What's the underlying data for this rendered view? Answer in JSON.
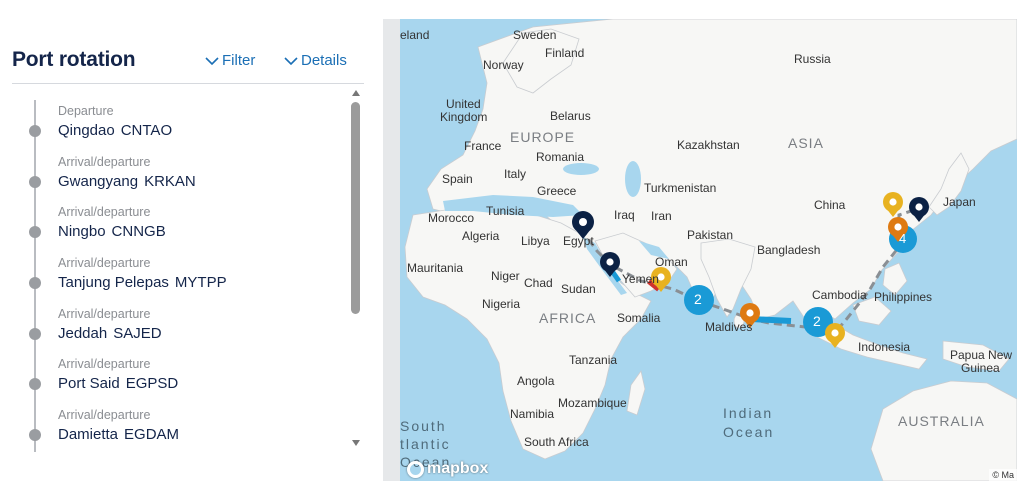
{
  "panel": {
    "title": "Port rotation",
    "filter_label": "Filter",
    "details_label": "Details",
    "stops": [
      {
        "kind": "Departure",
        "name": "Qingdao",
        "code": "CNTAO"
      },
      {
        "kind": "Arrival/departure",
        "name": "Gwangyang",
        "code": "KRKAN"
      },
      {
        "kind": "Arrival/departure",
        "name": "Ningbo",
        "code": "CNNGB"
      },
      {
        "kind": "Arrival/departure",
        "name": "Tanjung Pelepas",
        "code": "MYTPP"
      },
      {
        "kind": "Arrival/departure",
        "name": "Jeddah",
        "code": "SAJED"
      },
      {
        "kind": "Arrival/departure",
        "name": "Port Said",
        "code": "EGPSD"
      },
      {
        "kind": "Arrival/departure",
        "name": "Damietta",
        "code": "EGDAM"
      }
    ]
  },
  "map": {
    "labels": [
      {
        "text": "eland"
      },
      {
        "text": "Sweden"
      },
      {
        "text": "Finland"
      },
      {
        "text": "Norway"
      },
      {
        "text": "Russia"
      },
      {
        "text": "United"
      },
      {
        "text": "Kingdom"
      },
      {
        "text": "Belarus"
      },
      {
        "text": "France"
      },
      {
        "text": "Romania"
      },
      {
        "text": "Kazakhstan"
      },
      {
        "text": "Spain"
      },
      {
        "text": "Italy"
      },
      {
        "text": "Greece"
      },
      {
        "text": "Turkmenistan"
      },
      {
        "text": "Morocco"
      },
      {
        "text": "Tunisia"
      },
      {
        "text": "Iraq"
      },
      {
        "text": "Iran"
      },
      {
        "text": "China"
      },
      {
        "text": "Japan"
      },
      {
        "text": "Algeria"
      },
      {
        "text": "Libya"
      },
      {
        "text": "Egypt"
      },
      {
        "text": "Pakistan"
      },
      {
        "text": "Bangladesh"
      },
      {
        "text": "Mauritania"
      },
      {
        "text": "Niger"
      },
      {
        "text": "Chad"
      },
      {
        "text": "Oman"
      },
      {
        "text": "Sudan"
      },
      {
        "text": "Yemen"
      },
      {
        "text": "Nigeria"
      },
      {
        "text": "Cambodia"
      },
      {
        "text": "Philippines"
      },
      {
        "text": "Somalia"
      },
      {
        "text": "Maldives"
      },
      {
        "text": "Indonesia"
      },
      {
        "text": "Tanzania"
      },
      {
        "text": "Papua New"
      },
      {
        "text": "Guinea"
      },
      {
        "text": "Angola"
      },
      {
        "text": "Mozambique"
      },
      {
        "text": "Namibia"
      },
      {
        "text": "South Africa"
      }
    ],
    "regions": [
      "EUROPE",
      "ASIA",
      "AFRICA",
      "AUSTRALIA"
    ],
    "oceans": [
      "Indian",
      "Ocean",
      "South",
      "tlantic",
      "Ocean"
    ],
    "clusters": [
      "2",
      "2",
      "4"
    ],
    "logo_text": "mapbox",
    "attribution": "© Ma",
    "colors": {
      "water": "#a8d6ee",
      "land": "#f7f7f5",
      "route": "#8a8f94",
      "cluster": "#1a9ad6",
      "pin_navy": "#0b2144",
      "pin_orange": "#de7a12",
      "pin_yellow": "#e8b220"
    }
  }
}
